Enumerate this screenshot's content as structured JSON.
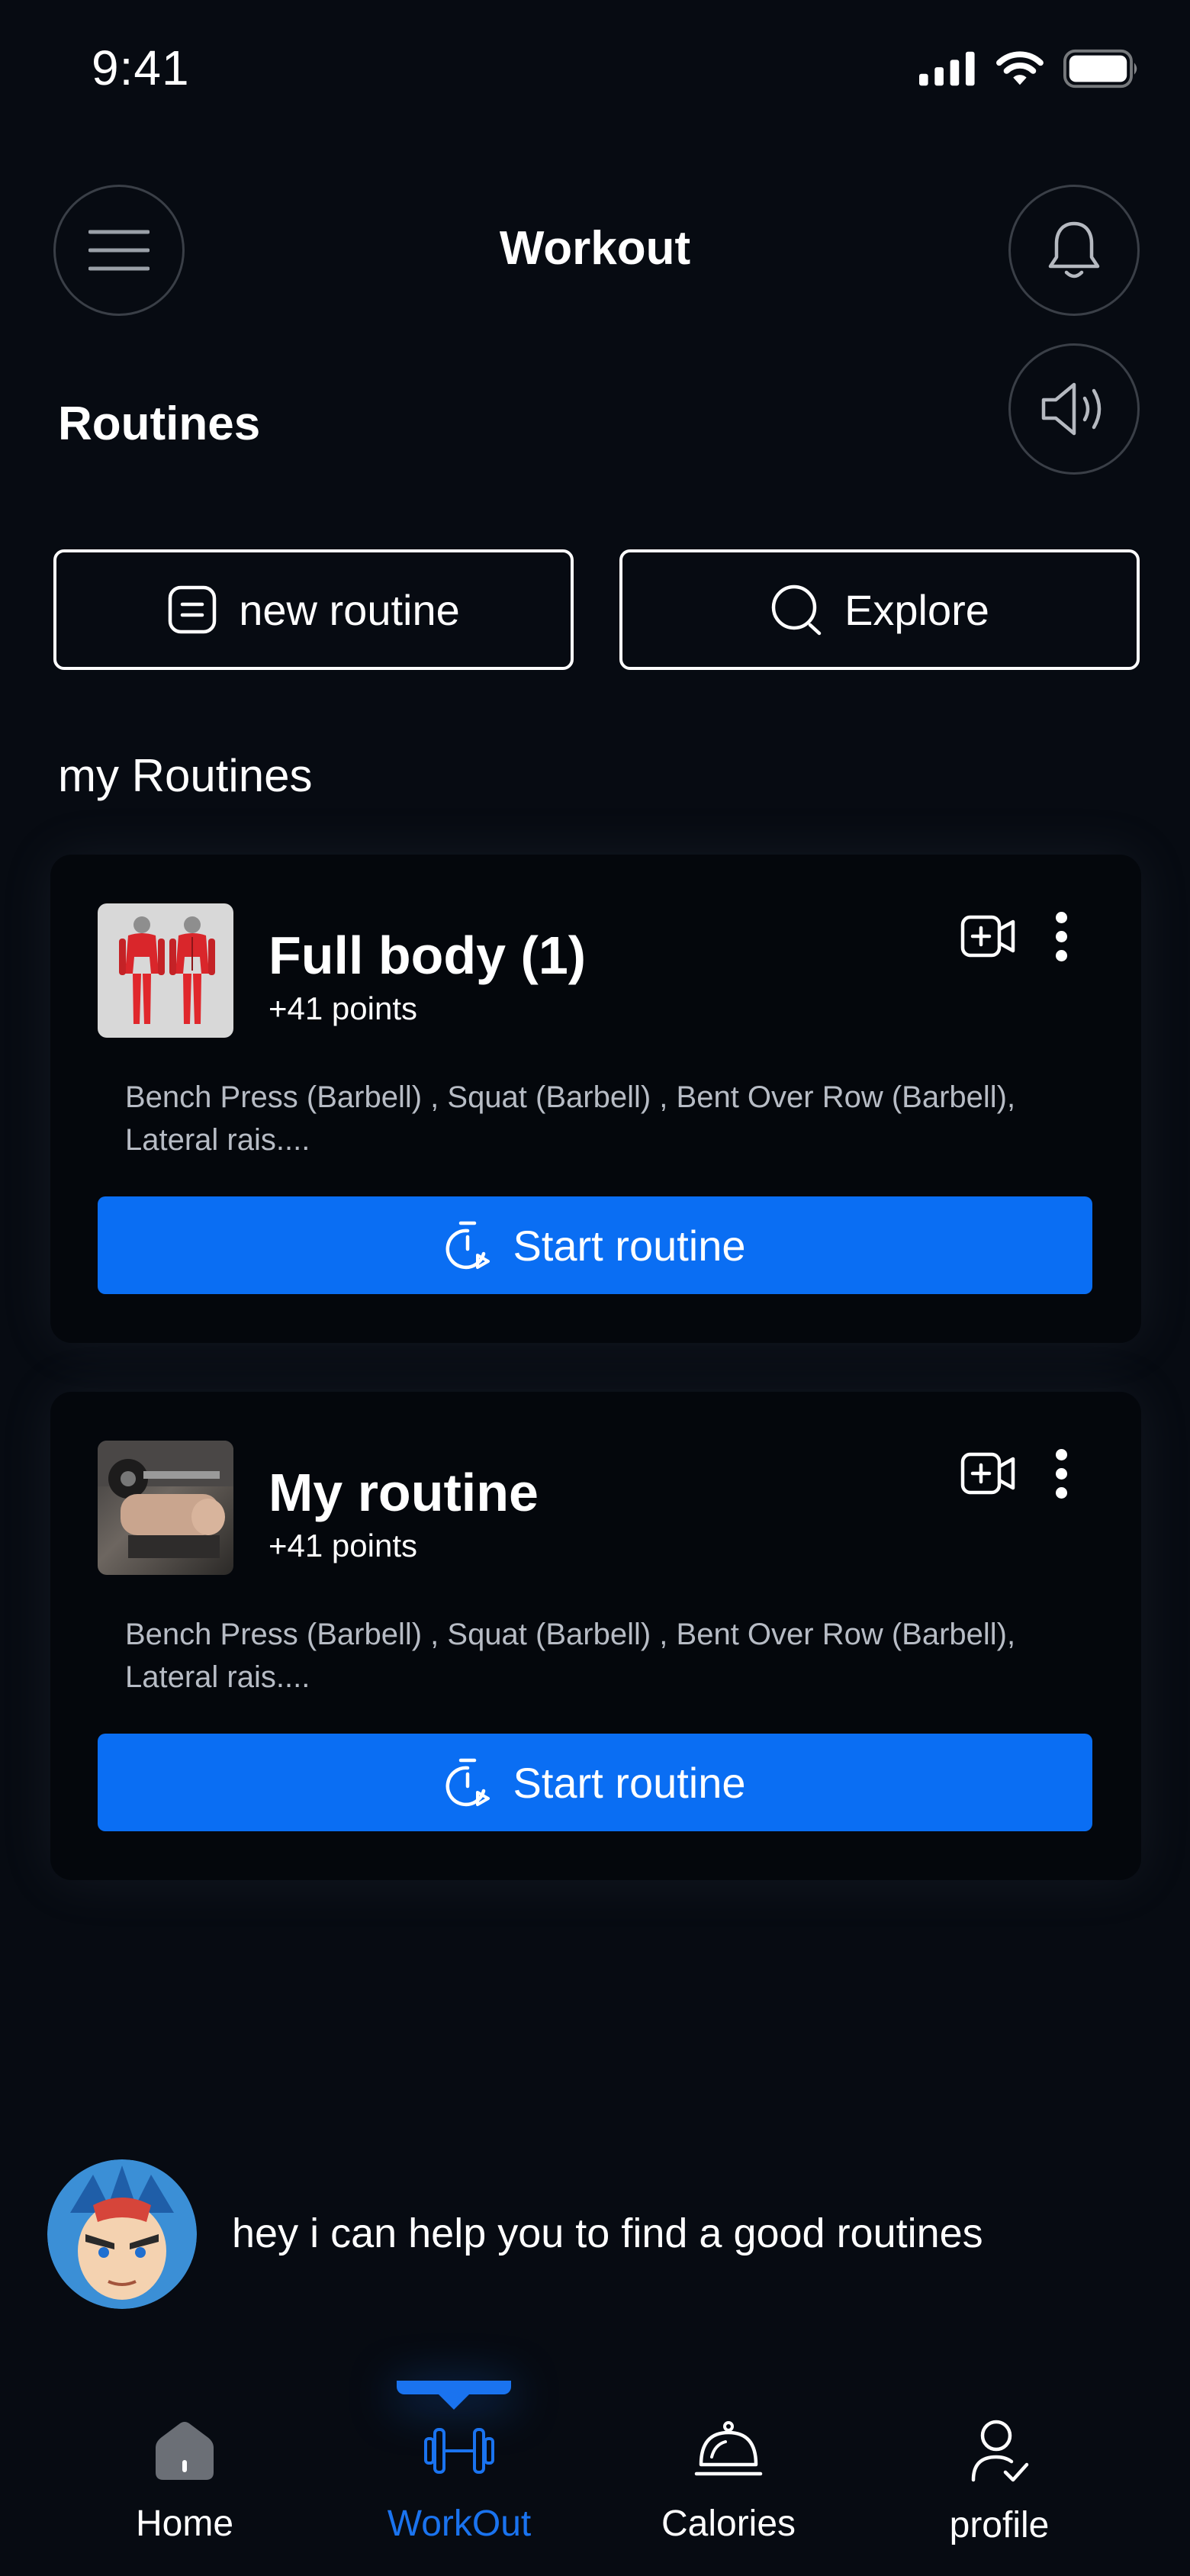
{
  "status_bar": {
    "time": "9:41"
  },
  "header": {
    "title": "Workout"
  },
  "section": {
    "title": "Routines"
  },
  "actions": {
    "new_routine": "new routine",
    "explore": "Explore"
  },
  "my_routines": {
    "title": "my Routines",
    "items": [
      {
        "name": "Full body (1)",
        "points": "+41 points",
        "description": "Bench Press (Barbell) , Squat (Barbell) , Bent Over Row (Barbell), Lateral rais....",
        "start_label": "Start routine"
      },
      {
        "name": "My routine",
        "points": "+41 points",
        "description": "Bench Press (Barbell) , Squat (Barbell) , Bent Over Row (Barbell), Lateral rais....",
        "start_label": "Start routine"
      }
    ]
  },
  "assistant": {
    "message": "hey i can help you to find a good routines"
  },
  "nav": {
    "items": [
      {
        "label": "Home",
        "icon": "home-icon"
      },
      {
        "label": "WorkOut",
        "icon": "dumbbell-icon",
        "active": true
      },
      {
        "label": "Calories",
        "icon": "food-cover-icon"
      },
      {
        "label": "profile",
        "icon": "user-check-icon"
      }
    ]
  },
  "colors": {
    "background": "#070b12",
    "accent": "#0a6ef3",
    "card": "#04070c"
  }
}
